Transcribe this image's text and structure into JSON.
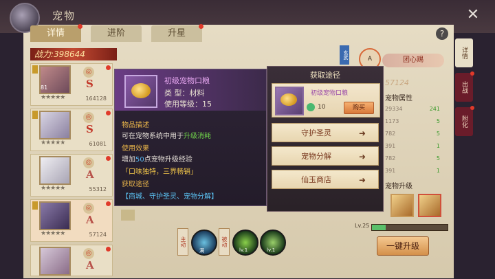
{
  "window": {
    "title": "宠物",
    "close_icon": "close-icon"
  },
  "tabs": [
    {
      "label": "详情",
      "active": true,
      "dot": true
    },
    {
      "label": "进阶",
      "active": false,
      "dot": false
    },
    {
      "label": "升星",
      "active": false,
      "dot": true
    }
  ],
  "help": "?",
  "power": {
    "label": "战力:398644"
  },
  "pets": [
    {
      "lv": "81",
      "rank": "S",
      "score": "164128"
    },
    {
      "lv": "",
      "rank": "S",
      "score": "61081"
    },
    {
      "lv": "",
      "rank": "A",
      "score": "55312"
    },
    {
      "lv": "",
      "rank": "A",
      "score": "57124"
    },
    {
      "lv": "",
      "rank": "A",
      "score": ""
    }
  ],
  "item": {
    "name": "初级宠物口粮",
    "type": "类      型：材料",
    "level": "使用等级：15",
    "desc_title": "物品描述",
    "desc_pre": "可在宠物系统中用于",
    "desc_hl": "升级消耗",
    "effect_title": "使用效果",
    "effect_pre": "增加",
    "effect_num": "50",
    "effect_post": "点宠物升级经验",
    "flavor": "「口味独特，三界畅销」",
    "source_title": "获取途径",
    "source": "【商城、守护圣灵、宠物分解】"
  },
  "acquire": {
    "title": "获取途径",
    "item_name": "初级宠物口粮",
    "count": "10",
    "buy": "购买",
    "routes": [
      "守护圣灵",
      "宠物分解",
      "仙玉商店"
    ]
  },
  "right": {
    "tabs": [
      "详情",
      "出战",
      "附化"
    ],
    "score": "57124",
    "attr_title": "宠物属性",
    "attrs": [
      {
        "v": "29334",
        "g": "241"
      },
      {
        "v": "1173",
        "g": "5"
      },
      {
        "v": "782",
        "g": "5"
      },
      {
        "v": "391",
        "g": "1"
      },
      {
        "v": "782",
        "g": "5"
      },
      {
        "v": "391",
        "g": "1"
      }
    ],
    "upgrade_title": "宠物升级",
    "lv_label": "Lv.25",
    "lv_progress": 0.18,
    "onekey": "一键升级",
    "circle_label": "A",
    "red_btn": "团心赐"
  },
  "skills": {
    "tag1": "主动",
    "tag2": "被动",
    "lv1": "满",
    "lv2": "lv.1",
    "lv3": "lv.1"
  }
}
